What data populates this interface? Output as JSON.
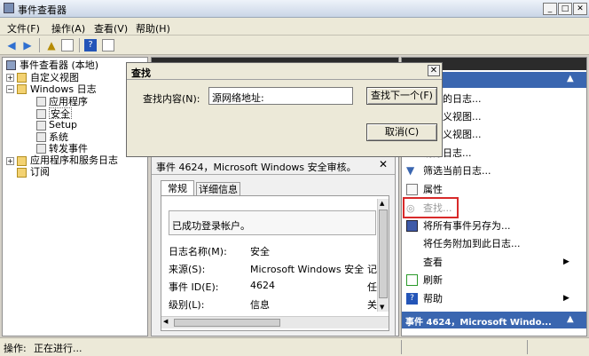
{
  "window": {
    "title": "事件查看器"
  },
  "menu": [
    "文件(F)",
    "操作(A)",
    "查看(V)",
    "帮助(H)"
  ],
  "tree": {
    "root": "事件查看器 (本地)",
    "custom_views": "自定义视图",
    "windows_logs": "Windows 日志",
    "logs": [
      "应用程序",
      "安全",
      "Setup",
      "系统",
      "转发事件"
    ],
    "app_services": "应用程序和服务日志",
    "subscriptions": "订阅"
  },
  "dialog": {
    "title": "查找",
    "label": "查找内容(N):",
    "value": "源网络地址:",
    "find_next": "查找下一个(F)",
    "cancel": "取消(C)",
    "close": "✕"
  },
  "event_panel": {
    "title": "事件 4624，Microsoft Windows 安全审核。",
    "tabs": [
      "常规",
      "详细信息"
    ],
    "summary": "已成功登录帐户。",
    "fields": [
      {
        "label": "日志名称(M):",
        "value": "安全"
      },
      {
        "label": "来源(S):",
        "value": "Microsoft Windows 安全审",
        "extra": "记"
      },
      {
        "label": "事件 ID(E):",
        "value": "4624",
        "extra": "任"
      },
      {
        "label": "级别(L):",
        "value": "信息",
        "extra": "关"
      }
    ]
  },
  "actions": {
    "items": [
      "保存的日志...",
      "自定义视图...",
      "自定义视图...",
      "清除日志...",
      "筛选当前日志...",
      "属性",
      "查找...",
      "将所有事件另存为...",
      "将任务附加到此日志...",
      "查看",
      "刷新",
      "帮助"
    ],
    "section2": "事件 4624，Microsoft Windo..."
  },
  "status": {
    "label": "操作:",
    "text": "正在进行..."
  },
  "colors": {
    "highlight": "#d82a2a",
    "section": "#3a66b0"
  }
}
